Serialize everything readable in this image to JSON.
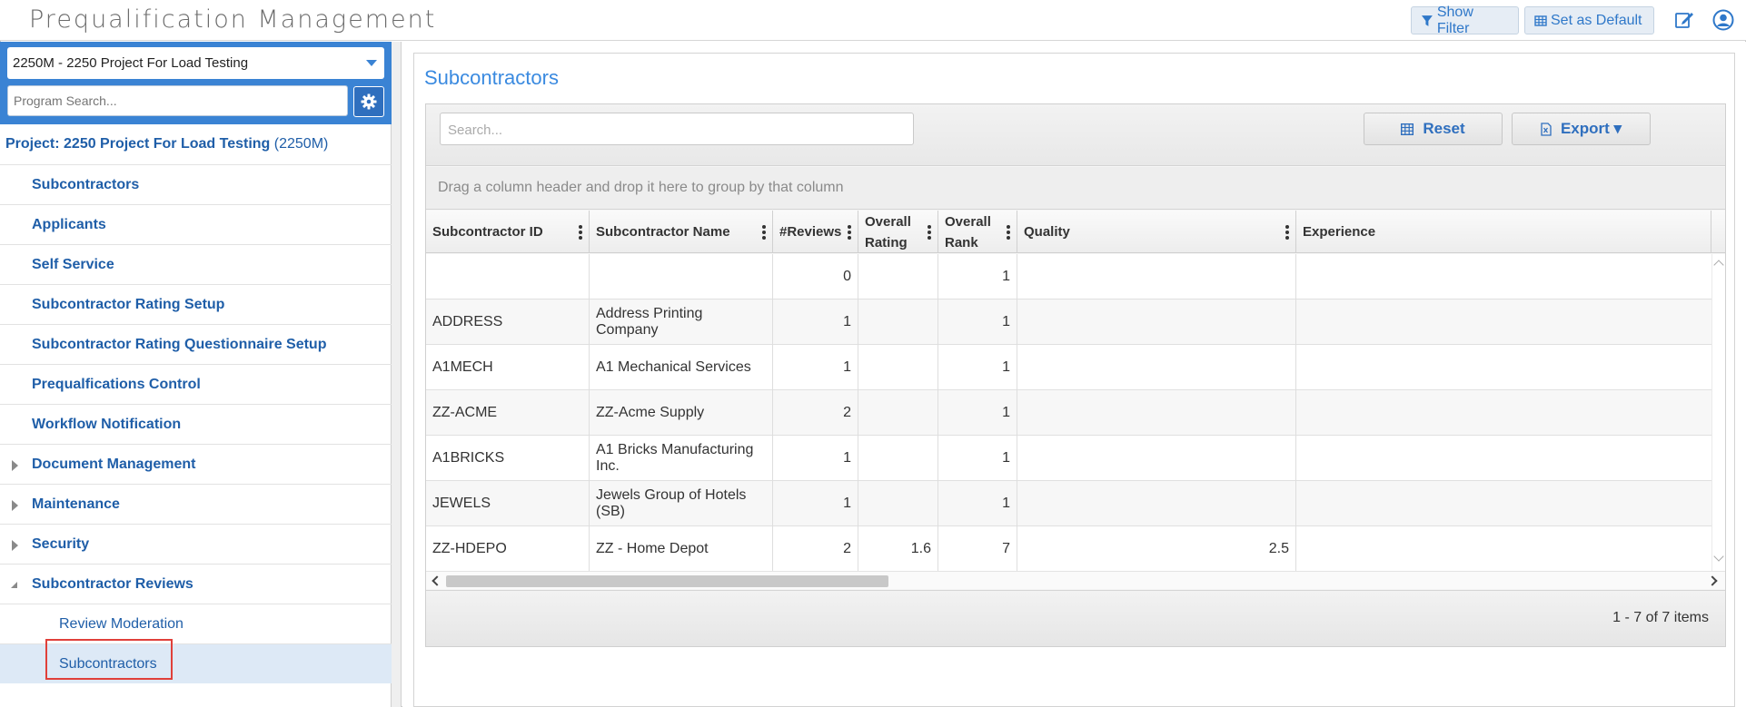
{
  "app": {
    "title": "Prequalification Management",
    "show_filter_label": "Show Filter",
    "set_default_label": "Set as Default"
  },
  "sidebar": {
    "project_select": "2250M - 2250 Project For Load Testing",
    "search_placeholder": "Program Search...",
    "project_label": "Project: 2250 Project For Load Testing",
    "project_code": "(2250M)",
    "items": [
      {
        "label": "Subcontractors"
      },
      {
        "label": "Applicants"
      },
      {
        "label": "Self Service"
      },
      {
        "label": "Subcontractor Rating Setup"
      },
      {
        "label": "Subcontractor Rating Questionnaire Setup"
      },
      {
        "label": "Prequalfications Control"
      },
      {
        "label": "Workflow Notification"
      },
      {
        "label": "Document Management"
      },
      {
        "label": "Maintenance"
      },
      {
        "label": "Security"
      },
      {
        "label": "Subcontractor Reviews"
      },
      {
        "label": "Review Moderation"
      },
      {
        "label": "Subcontractors"
      }
    ]
  },
  "main": {
    "title": "Subcontractors",
    "search_placeholder": "Search...",
    "reset_label": "Reset",
    "export_label": "Export ▾",
    "group_hint": "Drag a column header and drop it here to group by that column",
    "columns": [
      "Subcontractor ID",
      "Subcontractor Name",
      "#Reviews",
      "Overall Rating",
      "Overall Rank",
      "Quality",
      "Experience"
    ],
    "rows": [
      [
        "",
        "",
        "0",
        "",
        "1",
        "",
        ""
      ],
      [
        "ADDRESS",
        "Address Printing Company",
        "1",
        "",
        "1",
        "",
        ""
      ],
      [
        "A1MECH",
        "A1 Mechanical Services",
        "1",
        "",
        "1",
        "",
        ""
      ],
      [
        "ZZ-ACME",
        "ZZ-Acme Supply",
        "2",
        "",
        "1",
        "",
        ""
      ],
      [
        "A1BRICKS",
        "A1 Bricks Manufacturing Inc.",
        "1",
        "",
        "1",
        "",
        ""
      ],
      [
        "JEWELS",
        "Jewels Group of Hotels (SB)",
        "1",
        "",
        "1",
        "",
        ""
      ],
      [
        "ZZ-HDEPO",
        "ZZ - Home Depot",
        "2",
        "1.6",
        "7",
        "2.5",
        ""
      ]
    ],
    "pager_info": "1 - 7 of 7 items"
  },
  "colors": {
    "accent": "#3a83d4",
    "link": "#1f5ea8",
    "highlight_border": "#e0403a"
  }
}
